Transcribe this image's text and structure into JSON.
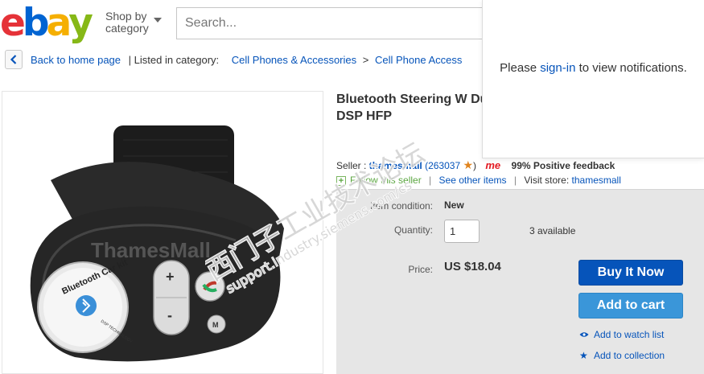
{
  "header": {
    "logo_letters": [
      "e",
      "b",
      "a",
      "y"
    ],
    "logo_colors": [
      "#e53238",
      "#0064d2",
      "#f5af02",
      "#86b817"
    ],
    "shop_by_line1": "Shop by",
    "shop_by_line2": "category",
    "search_placeholder": "Search..."
  },
  "breadcrumb": {
    "back_label": "Back to home page",
    "listed_label": "| Listed in category:",
    "category_1": "Cell Phones & Accessories",
    "separator": ">",
    "category_2": "Cell Phone Access"
  },
  "product": {
    "title": "Bluetooth Steering W Duplex DSP HFP",
    "image_label": "Bluetooth Car kit",
    "image_brand": "ThamesMall",
    "image_tech": "DSP TECHNOLOGY"
  },
  "seller": {
    "prefix": "Seller :",
    "name": "thamesmall",
    "score_open": "(263037",
    "score_close": ")",
    "me_badge": "me",
    "feedback": "99% Positive feedback",
    "follow": "Follow this seller",
    "other_items": "See other items",
    "visit_store": "Visit store:",
    "store_name": "thamesmall"
  },
  "purchase": {
    "condition_label": "Item condition:",
    "condition_value": "New",
    "quantity_label": "Quantity:",
    "quantity_value": "1",
    "available": "3 available",
    "price_label": "Price:",
    "price_value": "US $18.04",
    "buy_now": "Buy It Now",
    "add_to_cart": "Add to cart",
    "watch_list": "Add to watch list",
    "collection": "Add to collection"
  },
  "notifications": {
    "pre": "Please ",
    "link": "sign-in",
    "post": " to view notifications."
  },
  "watermark": {
    "line1": "西门子工业技术论坛",
    "line2": "support.industry.siemens.com/cs"
  },
  "colors": {
    "link_blue": "#0654ba",
    "buy_button": "#0654ba",
    "cart_button": "#3a96d9",
    "buy_box_bg": "#e6e6e6"
  }
}
